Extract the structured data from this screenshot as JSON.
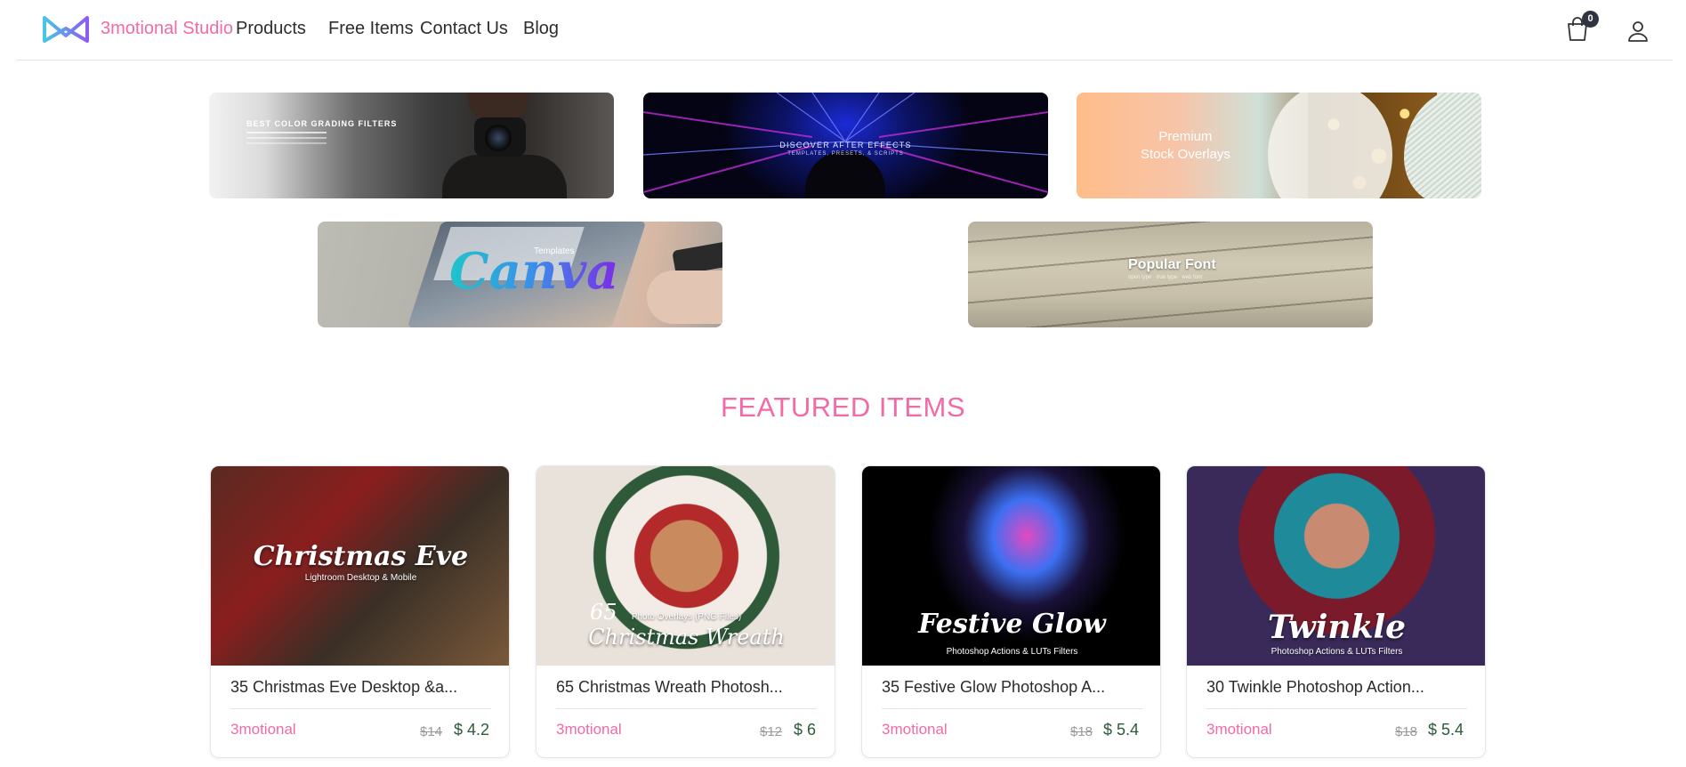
{
  "header": {
    "brand": "3motional Studio",
    "nav": {
      "products": "Products",
      "free_items": "Free Items",
      "contact_us": "Contact Us",
      "blog": "Blog"
    },
    "cart_count": "0",
    "icons": [
      "logo-icon",
      "shopping-bag-icon",
      "user-icon"
    ]
  },
  "banners": {
    "color_grading": {
      "text": "BEST COLOR GRADING FILTERS"
    },
    "after_effects": {
      "text": "DISCOVER AFTER EFFECTS",
      "sub": "TEMPLATES, PRESETS, & SCRIPTS"
    },
    "stock_overlays": {
      "line1": "Premium",
      "line2": "Stock Overlays"
    },
    "canva": {
      "word": "Canva",
      "sub": "Templates"
    },
    "popular_font": {
      "text": "Popular Font",
      "sub": "open type · true type · web font"
    }
  },
  "featured": {
    "title": "FEATURED ITEMS",
    "items": [
      {
        "title": "35 Christmas Eve Desktop &a...",
        "overlay_title": "Christmas Eve",
        "overlay_sub": "Lightroom Desktop & Mobile",
        "vendor": "3motional",
        "old_price": "$14",
        "new_price": "$ 4.2"
      },
      {
        "title": "65 Christmas Wreath Photosh...",
        "overlay_num": "65",
        "overlay_title": "Christmas Wreath",
        "overlay_sub": "Photo Overlays (PNG Files)",
        "vendor": "3motional",
        "old_price": "$12",
        "new_price": "$ 6"
      },
      {
        "title": "35 Festive Glow Photoshop A...",
        "overlay_title": "Festive Glow",
        "overlay_sub": "Photoshop Actions & LUTs Filters",
        "vendor": "3motional",
        "old_price": "$18",
        "new_price": "$ 5.4"
      },
      {
        "title": "30 Twinkle Photoshop Action...",
        "overlay_title": "Twinkle",
        "overlay_sub": "Photoshop Actions & LUTs Filters",
        "vendor": "3motional",
        "old_price": "$18",
        "new_price": "$ 5.4"
      }
    ]
  },
  "colors": {
    "accent_pink": "#f26aa6",
    "price_green": "#2b5a3a",
    "badge_dark": "#2f3440"
  }
}
